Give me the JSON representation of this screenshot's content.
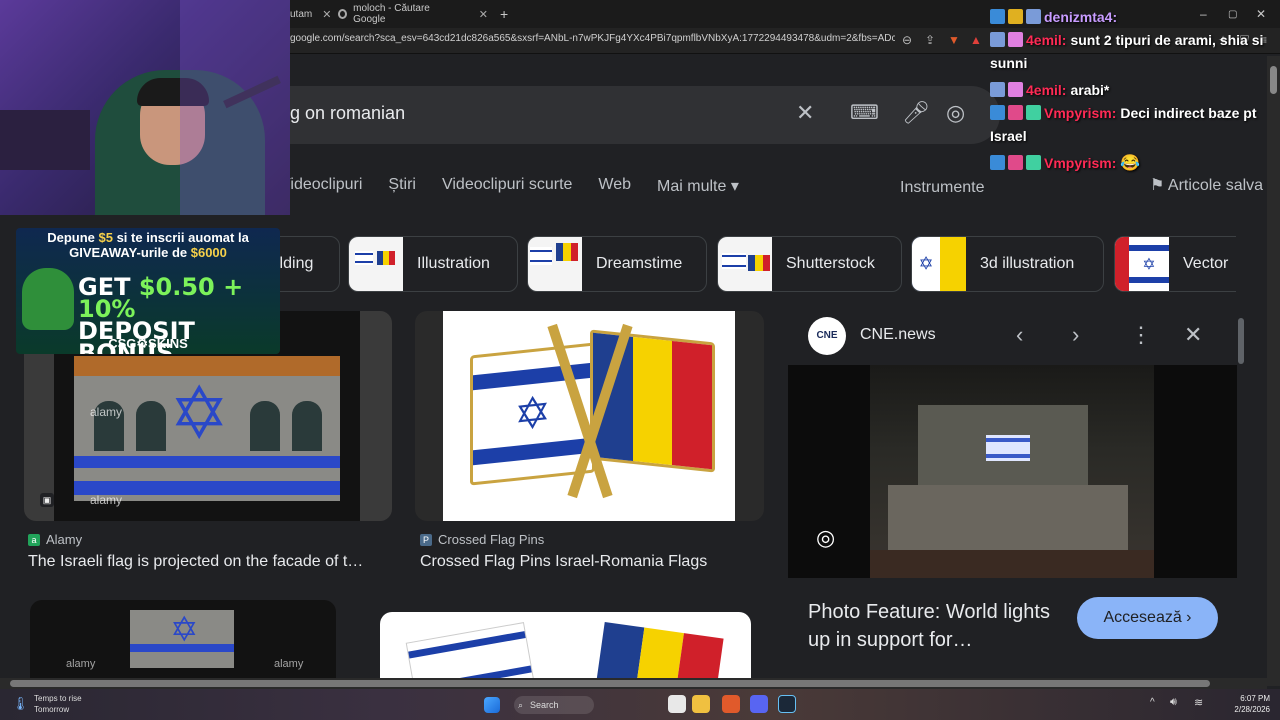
{
  "browser": {
    "tabs": [
      {
        "label": "utam",
        "x_label": "✕"
      },
      {
        "label": "moloch - Căutare Google",
        "x_label": "✕"
      }
    ],
    "new_tab": "+",
    "url": "google.com/search?sca_esv=643cd21dc826a565&sxsrf=ANbL-n7wPKJFg4YXc4PBi7qpmflbVNbXyA:1772294493478&udm=2&fbs=ADc_l-Zh6vg..."
  },
  "search": {
    "query": "g on romanian",
    "clear_icon": "close-icon",
    "keyboard_icon": "keyboard-icon",
    "mic_icon": "mic-icon",
    "lens_icon": "camera-search-icon"
  },
  "nav_tabs": [
    "Videoclipuri",
    "Știri",
    "Videoclipuri scurte",
    "Web",
    "Mai multe ▾"
  ],
  "tools_label": "Instrumente",
  "saved_label": "Articole salva",
  "chips": [
    "ilding",
    "Illustration",
    "Dreamstime",
    "Shutterstock",
    "3d illustration",
    "Vector"
  ],
  "results": [
    {
      "source": "Alamy",
      "caption": "The Israeli flag is projected on the facade of t…",
      "watermark": "alamy"
    },
    {
      "source": "Crossed Flag Pins",
      "caption": "Crossed Flag Pins Israel-Romania Flags"
    }
  ],
  "panel": {
    "logo": "CNE",
    "source": "CNE.news",
    "title": "Photo Feature: World lights up in support for…",
    "button": "Accesează ›"
  },
  "ad": {
    "line1_pre": "Depune ",
    "line1_amount": "$5",
    "line1_post": " si te inscrii auomat la",
    "line2_pre": "GIVEAWAY-urile de ",
    "line2_amount": "$6000",
    "main1_pre": "GET ",
    "main1_amount": "$0.50 + 10%",
    "main2": "DEPOSIT BONUS",
    "brand": "CSG⚙SKINS"
  },
  "chat": [
    {
      "user": "denizmta4:",
      "color": "#c89cff",
      "text": ""
    },
    {
      "user": "4emil:",
      "color": "#ff2a55",
      "text": "sunt 2 tipuri de arami, shia si sunni"
    },
    {
      "user": "4emil:",
      "color": "#ff2a55",
      "text": "arabi*"
    },
    {
      "user": "Vmpyrism:",
      "color": "#ff2a55",
      "text": "Deci indirect baze pt Israel"
    },
    {
      "user": "Vmpyrism:",
      "color": "#ff2a55",
      "text": ""
    }
  ],
  "taskbar": {
    "weather_title": "Temps to rise",
    "weather_sub": "Tomorrow",
    "search": "Search",
    "time": "6:07 PM",
    "date": "2/28/2026"
  },
  "colors": {
    "accent": "#8ab4f8",
    "israel_blue": "#1c3fa8",
    "ro_blue": "#1f3f8f",
    "ro_yellow": "#f6d200",
    "ro_red": "#d0202a"
  }
}
